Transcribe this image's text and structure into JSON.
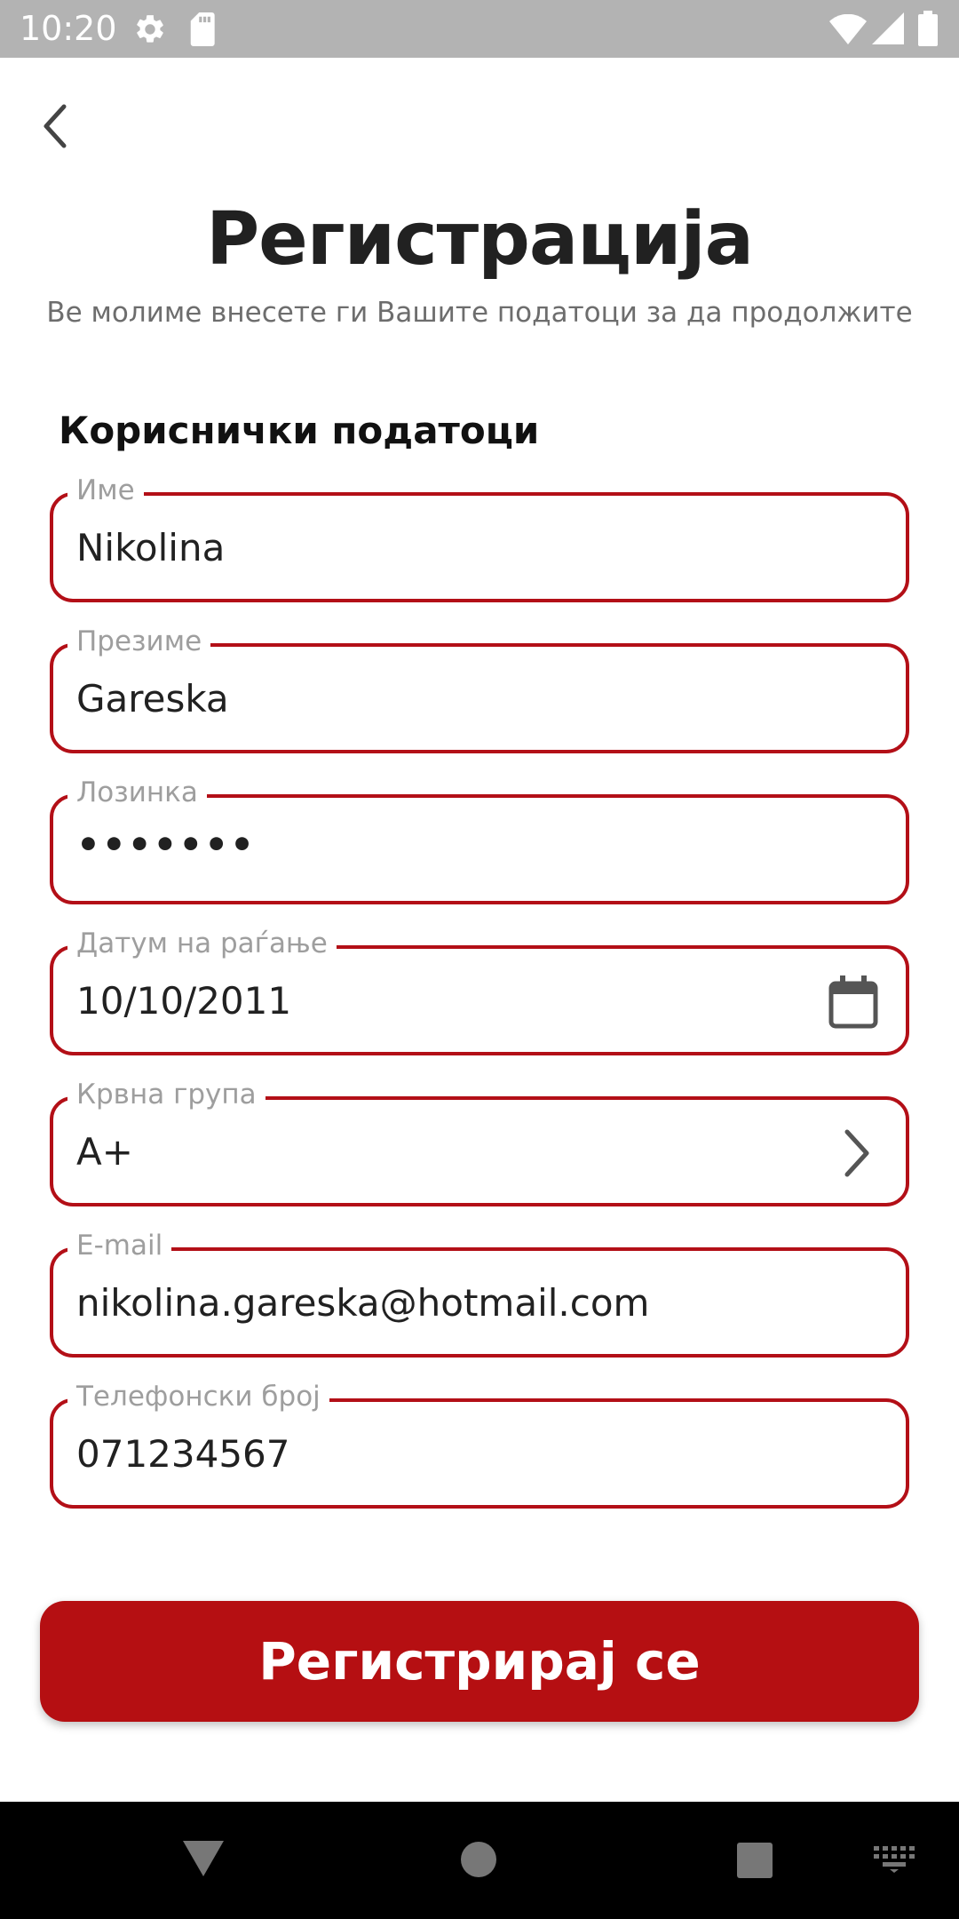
{
  "status_bar": {
    "time": "10:20",
    "icons": [
      "settings-icon",
      "sd-card-icon",
      "wifi-icon",
      "signal-icon",
      "battery-icon"
    ]
  },
  "header": {
    "back_icon": "chevron-left-icon",
    "title": "Регистрација",
    "subtitle": "Ве молиме внесете ги Вашите податоци за да продолжите"
  },
  "form": {
    "section_title": "Кориснички податоци",
    "fields": [
      {
        "label": "Име",
        "value": "Nikolina"
      },
      {
        "label": "Презиме",
        "value": "Gareska"
      },
      {
        "label": "Лозинка",
        "value": "•••••••"
      },
      {
        "label": "Датум на раѓање",
        "value": "10/10/2011",
        "trailing_icon": "calendar-icon"
      },
      {
        "label": "Крвна група",
        "value": "A+",
        "trailing_icon": "chevron-right-icon"
      },
      {
        "label": "E-mail",
        "value": "nikolina.gareska@hotmail.com"
      },
      {
        "label": "Телефонски број",
        "value": "071234567"
      }
    ],
    "submit_label": "Регистрирај се"
  },
  "colors": {
    "accent": "#b50f12",
    "field_border": "#b30f17",
    "label": "#9e9e9e",
    "status_bar": "#b3b3b3",
    "nav_bar": "#000000"
  },
  "nav_bar": {
    "buttons": [
      "back-triangle-icon",
      "home-circle-icon",
      "recents-square-icon",
      "keyboard-icon"
    ]
  }
}
